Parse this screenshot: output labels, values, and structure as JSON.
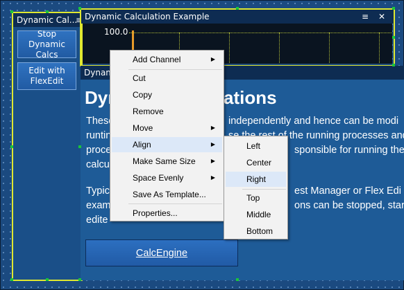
{
  "left_panel": {
    "title": "Dynamic Cal...",
    "menu_glyph": "≡",
    "buttons": [
      {
        "label_lines": [
          "Stop Dynamic",
          "Calcs"
        ]
      },
      {
        "label_lines": [
          "Edit with",
          "FlexEdit"
        ]
      }
    ]
  },
  "chart_panel": {
    "title": "Dynamic Calculation Example",
    "menu_glyph": "≡",
    "close_glyph": "✕",
    "y_top_tick": "100.0"
  },
  "info_panel": {
    "title_visible_part": "Dyn",
    "title_visible_tail": "ations",
    "tab_title_fragment": "Dynami",
    "text_lines": [
      {
        "left": "These",
        "right": "independently and hence can be modi"
      },
      {
        "left": "runtin",
        "right": "se the rest of the running processes and"
      },
      {
        "left": "proce",
        "right": "sponsible for running the"
      },
      {
        "left": "calcu",
        "right": ""
      }
    ],
    "text_lines2": [
      {
        "left": "Typic",
        "right": "est Manager or Flex Edi"
      },
      {
        "left": "exam",
        "right": "ons can be stopped, star"
      },
      {
        "left": "edite",
        "right": ""
      }
    ],
    "button_label": "CalcEngine"
  },
  "context_menu": {
    "items": [
      {
        "label": "Add Channel",
        "submenu": true
      },
      {
        "label": "Cut",
        "submenu": false
      },
      {
        "label": "Copy",
        "submenu": false
      },
      {
        "label": "Remove",
        "submenu": false
      },
      {
        "label": "Move",
        "submenu": true
      },
      {
        "label": "Align",
        "submenu": true,
        "highlighted": true
      },
      {
        "label": "Make Same Size",
        "submenu": true
      },
      {
        "label": "Space Evenly",
        "submenu": true
      },
      {
        "label": "Save As Template...",
        "submenu": false
      },
      {
        "label": "Properties...",
        "submenu": false
      }
    ],
    "arrow_glyph": "▶"
  },
  "align_submenu": {
    "items": [
      {
        "label": "Left"
      },
      {
        "label": "Center"
      },
      {
        "label": "Right",
        "highlighted": true
      },
      {
        "label": "Top"
      },
      {
        "label": "Middle"
      },
      {
        "label": "Bottom"
      }
    ]
  },
  "colors": {
    "workspace": "#1b4a80",
    "selection": "#e0e830",
    "handle": "#19c63a",
    "menu_highlight": "#dce8f8"
  }
}
